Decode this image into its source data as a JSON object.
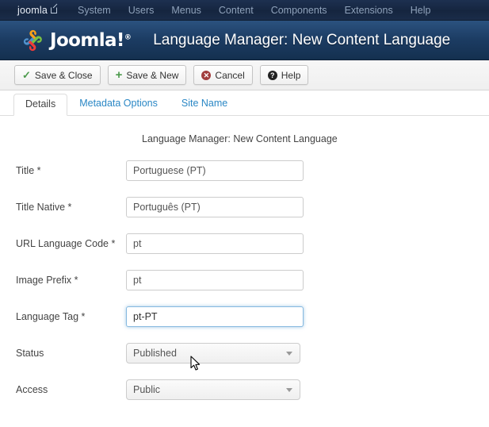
{
  "topnav": {
    "brand": "joomla",
    "brand_icon": "external-link-icon",
    "items": [
      {
        "label": "System"
      },
      {
        "label": "Users"
      },
      {
        "label": "Menus"
      },
      {
        "label": "Content"
      },
      {
        "label": "Components"
      },
      {
        "label": "Extensions"
      },
      {
        "label": "Help"
      }
    ]
  },
  "header": {
    "logo_text": "Joomla!",
    "logo_sup": "®",
    "logo_icon": "joomla-logo-icon",
    "title": "Language Manager: New Content Language"
  },
  "toolbar": {
    "buttons": [
      {
        "label": "Save & Close",
        "icon": "check-icon"
      },
      {
        "label": "Save & New",
        "icon": "plus-icon"
      },
      {
        "label": "Cancel",
        "icon": "cancel-icon",
        "glyph": "✕"
      },
      {
        "label": "Help",
        "icon": "help-icon",
        "glyph": "?"
      }
    ]
  },
  "tabs": [
    {
      "label": "Details",
      "active": true
    },
    {
      "label": "Metadata Options",
      "active": false
    },
    {
      "label": "Site Name",
      "active": false
    }
  ],
  "form": {
    "subtitle": "Language Manager: New Content Language",
    "fields": [
      {
        "label": "Title *",
        "value": "Portuguese (PT)",
        "type": "text",
        "focused": false
      },
      {
        "label": "Title Native *",
        "value": "Português (PT)",
        "type": "text",
        "focused": false
      },
      {
        "label": "URL Language Code *",
        "value": "pt",
        "type": "text",
        "focused": false
      },
      {
        "label": "Image Prefix *",
        "value": "pt",
        "type": "text",
        "focused": false
      },
      {
        "label": "Language Tag *",
        "value": "pt-PT",
        "type": "text",
        "focused": true
      },
      {
        "label": "Status",
        "value": "Published",
        "type": "select",
        "focused": false
      },
      {
        "label": "Access",
        "value": "Public",
        "type": "select",
        "focused": false
      }
    ]
  },
  "colors": {
    "nav_bg": "#15253f",
    "header_bg": "#1c3c63",
    "tab_link": "#2a87c5",
    "focus_border": "#86b9e0",
    "icon_green": "#4c9a4c",
    "icon_red": "#a13d3d"
  }
}
